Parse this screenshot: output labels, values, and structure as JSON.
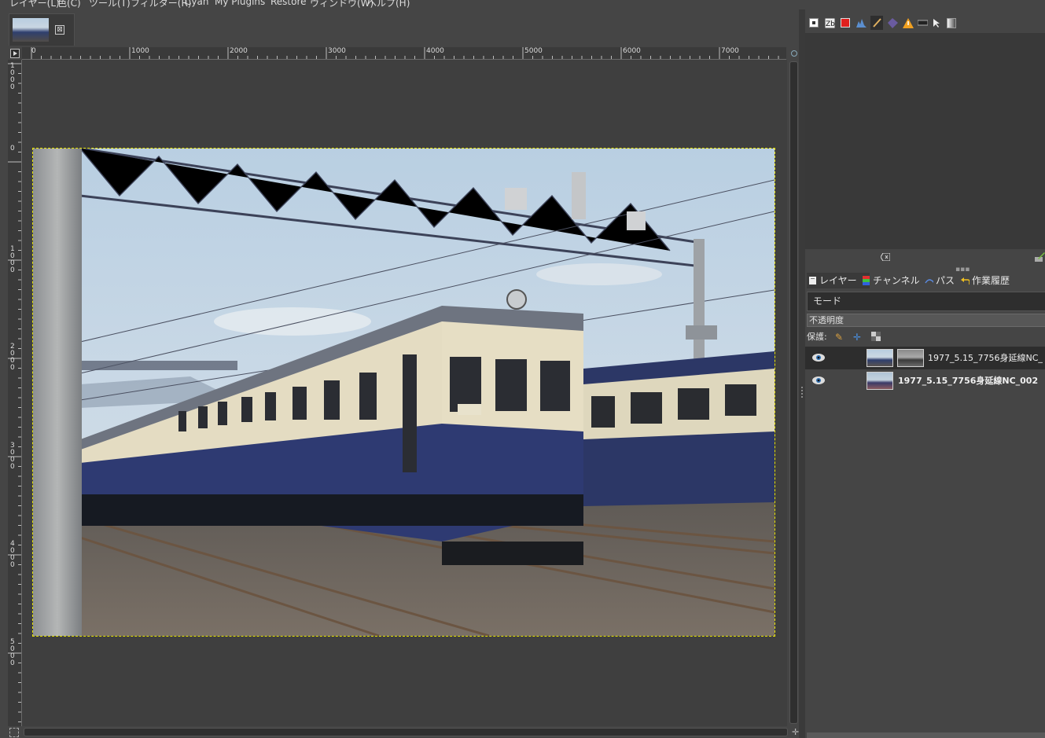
{
  "menubar": [
    "レイヤー(L)",
    "色(C)",
    "ツール(T)",
    "フィルター(R)",
    "Cyan",
    "My Plugins",
    "Restore",
    "ウィンドウ(W)",
    "ヘルプ(H)"
  ],
  "image_tab": {
    "close_glyph": "⊠"
  },
  "ruler": {
    "h_labels": [
      "0",
      "1000",
      "2000",
      "3000",
      "4000",
      "5000",
      "6000",
      "7000"
    ],
    "v_labels": [
      "1000",
      "0",
      "1000",
      "2000",
      "3000",
      "4000",
      "5000"
    ]
  },
  "dock_icons": [
    "image-icon",
    "font-icon",
    "color-swatch-icon",
    "histogram-icon",
    "brush-icon",
    "pattern-icon",
    "warning-icon",
    "gradient-editor-icon",
    "pointer-icon",
    "gradient-icon"
  ],
  "layers_panel": {
    "tabs": [
      "レイヤー",
      "チャンネル",
      "パス",
      "作業履歴"
    ],
    "mode_label": "モード",
    "opacity_label": "不透明度",
    "lock_label": "保護:",
    "layers": [
      {
        "name": "1977_5.15_7756身延線NC_",
        "has_mask": true,
        "bold": false
      },
      {
        "name": "1977_5.15_7756身延線NC_002",
        "has_mask": false,
        "bold": true
      }
    ]
  },
  "colors": {
    "accent": "#e8e400",
    "panel": "#454545",
    "canvas": "#3f3f3f"
  }
}
